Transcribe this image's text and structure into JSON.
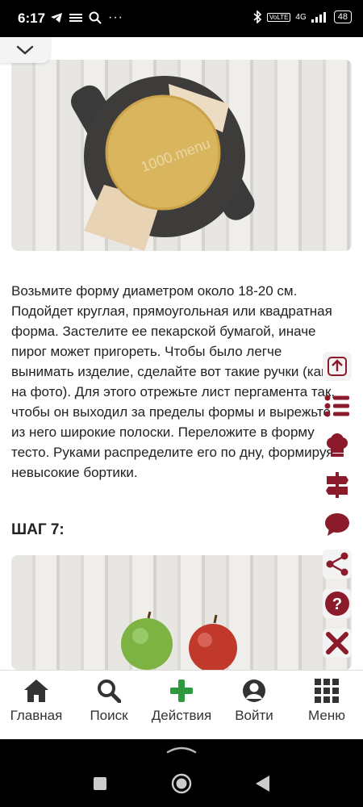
{
  "status_bar": {
    "time": "6:17",
    "network": "4G",
    "battery": "48"
  },
  "step_text": "Возьмите форму диаметром около 18-20 см. Подойдет круглая, прямоугольная или квадратная форма. Застелите ее пекарской бумагой, иначе пирог может пригореть. Чтобы было легче вынимать изделие, сделайте вот такие ручки (как на фото). Для этого отрежьте лист пергамента так, чтобы он выходил за пределы формы и вырежьте из него широкие полоски. Переложите в форму тесто. Руками распределите его по дну, формируя невысокие бортики.",
  "next_step_heading": "ШАГ 7:",
  "watermark": "1000.menu",
  "bottom_nav": [
    {
      "label": "Главная",
      "icon": "home-icon"
    },
    {
      "label": "Поиск",
      "icon": "search-icon"
    },
    {
      "label": "Действия",
      "icon": "plus-icon"
    },
    {
      "label": "Войти",
      "icon": "user-icon"
    },
    {
      "label": "Меню",
      "icon": "grid-icon"
    }
  ],
  "side_actions": [
    "scroll-up-icon",
    "list-icon",
    "chef-hat-icon",
    "signpost-icon",
    "comment-icon",
    "share-icon",
    "help-icon",
    "close-icon"
  ],
  "colors": {
    "accent": "#8b1a2b",
    "green": "#2e9a3f"
  }
}
